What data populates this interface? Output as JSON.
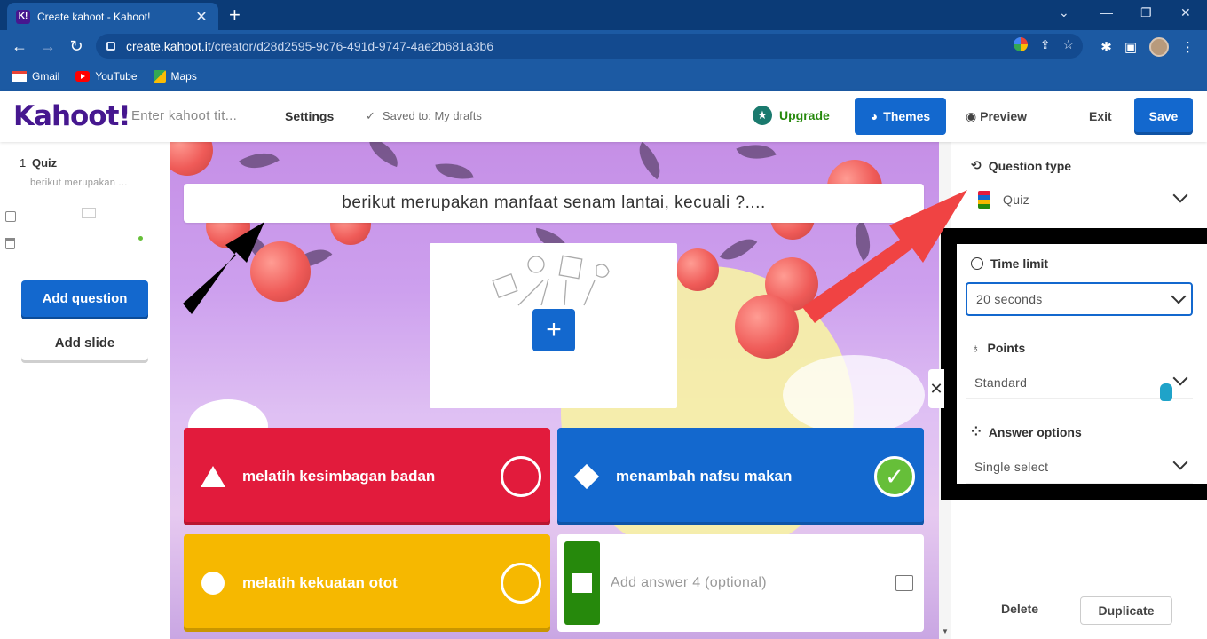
{
  "browser": {
    "tab_title": "Create kahoot - Kahoot!",
    "tab_favicon": "K!",
    "url_host": "create.kahoot.it",
    "url_path": "/creator/d28d2595-9c76-491d-9747-4ae2b681a3b6",
    "bookmarks": [
      {
        "label": "Gmail",
        "icon": "gmail-icon"
      },
      {
        "label": "YouTube",
        "icon": "youtube-icon"
      },
      {
        "label": "Maps",
        "icon": "maps-icon"
      }
    ]
  },
  "topbar": {
    "logo": "Kahoot!",
    "title_placeholder": "Enter kahoot tit...",
    "settings_label": "Settings",
    "saved_label": "Saved to: My drafts",
    "upgrade_label": "Upgrade",
    "themes_label": "Themes",
    "preview_label": "Preview",
    "exit_label": "Exit",
    "save_label": "Save"
  },
  "sidebar": {
    "slides": [
      {
        "number": "1",
        "type": "Quiz",
        "preview": "berikut merupakan ..."
      }
    ],
    "add_question_label": "Add question",
    "add_slide_label": "Add slide"
  },
  "editor": {
    "question": "berikut merupakan manfaat senam lantai, kecuali ?....",
    "answers": [
      {
        "text": "melatih kesimbagan badan",
        "color": "#e21b3c",
        "shape": "triangle",
        "correct": false
      },
      {
        "text": "menambah nafsu makan",
        "color": "#1368ce",
        "shape": "diamond",
        "correct": true
      },
      {
        "text": "melatih kekuatan otot",
        "color": "#f6b800",
        "shape": "circle",
        "correct": false
      },
      {
        "text": "",
        "placeholder": "Add answer 4 (optional)",
        "color": "#26890c",
        "shape": "square",
        "correct": false
      }
    ]
  },
  "panel": {
    "question_type_label": "Question type",
    "question_type_value": "Quiz",
    "time_limit_label": "Time limit",
    "time_limit_value": "20 seconds",
    "points_label": "Points",
    "points_value": "Standard",
    "answer_options_label": "Answer options",
    "answer_options_value": "Single select",
    "delete_label": "Delete",
    "duplicate_label": "Duplicate"
  },
  "colors": {
    "brand_purple": "#46178f",
    "primary_blue": "#1368ce",
    "upgrade_green": "#26890c",
    "annotation_red": "#f04343",
    "annotation_black": "#000000"
  }
}
